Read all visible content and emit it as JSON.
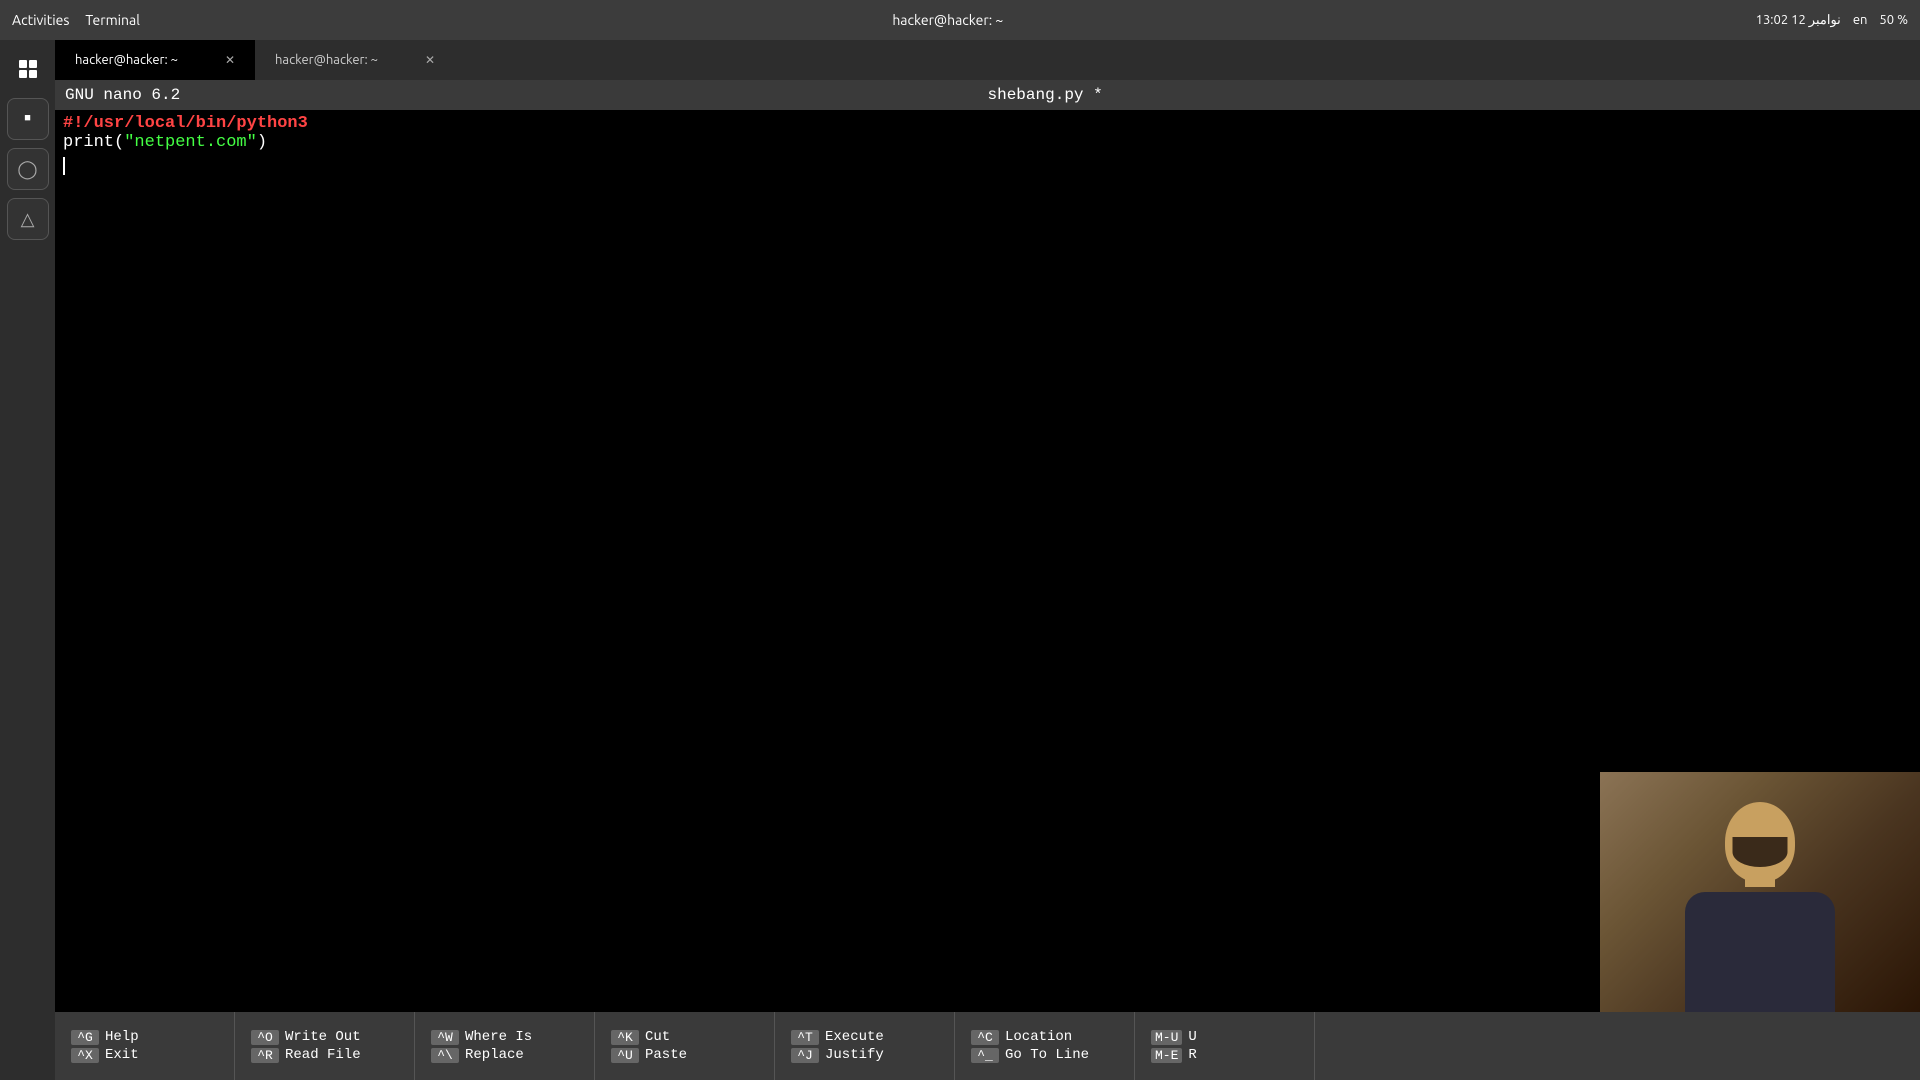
{
  "system_bar": {
    "activities": "Activities",
    "terminal": "Terminal",
    "time": "13:02",
    "date": "12 نوامبر",
    "battery": "50 %",
    "language": "en"
  },
  "tabs": [
    {
      "id": "tab1",
      "label": "hacker@hacker: ~",
      "active": true
    },
    {
      "id": "tab2",
      "label": "hacker@hacker: ~",
      "active": false
    }
  ],
  "window_title": "hacker@hacker: ~",
  "nano": {
    "version": "GNU nano 6.2",
    "filename": "shebang.py *",
    "line1": "#!/usr/local/bin/python3",
    "line2_prefix": "print(",
    "line2_string": "\"netpent.com\"",
    "line2_suffix": ")"
  },
  "shortcuts": [
    {
      "items": [
        {
          "key": "^G",
          "label": "Help"
        },
        {
          "key": "^X",
          "label": "Exit"
        }
      ]
    },
    {
      "items": [
        {
          "key": "^O",
          "label": "Write Out"
        },
        {
          "key": "^R",
          "label": "Read File"
        }
      ]
    },
    {
      "items": [
        {
          "key": "^W",
          "label": "Where Is"
        },
        {
          "key": "^\\",
          "label": "Replace"
        }
      ]
    },
    {
      "items": [
        {
          "key": "^K",
          "label": "Cut"
        },
        {
          "key": "^U",
          "label": "Paste"
        }
      ]
    },
    {
      "items": [
        {
          "key": "^T",
          "label": "Execute"
        },
        {
          "key": "^J",
          "label": "Justify"
        }
      ]
    },
    {
      "items": [
        {
          "key": "^C",
          "label": "Location"
        },
        {
          "key": "^_",
          "label": "Go To Line"
        }
      ]
    },
    {
      "items": [
        {
          "key": "M-U",
          "label": "U"
        },
        {
          "key": "M-E",
          "label": "R"
        }
      ]
    }
  ]
}
